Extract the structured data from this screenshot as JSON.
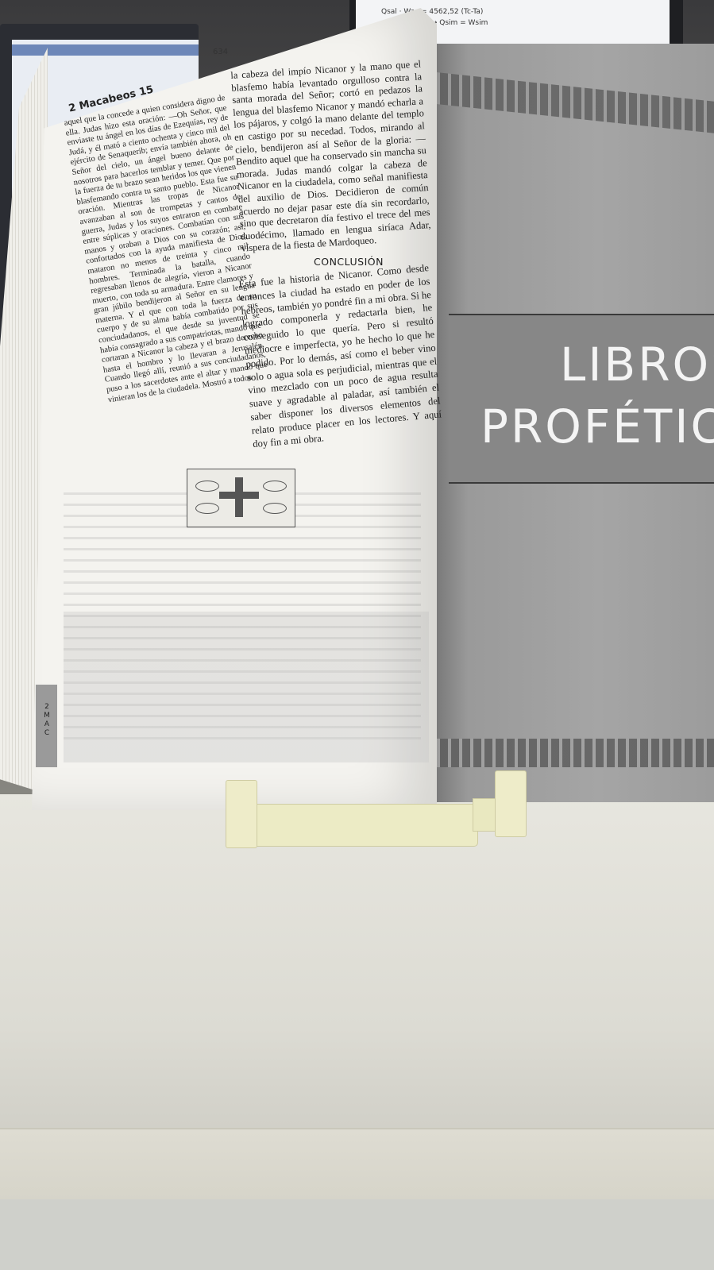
{
  "photo": {
    "subject": "open-bible-on-book-stand"
  },
  "left_page": {
    "running_head": "2 Macabeos 15",
    "page_number": "634",
    "section_heading": "CONCLUSIÓN",
    "thumb_tab": "2 MAC",
    "column_left_text": "aquel que la concede a quien considera digno de ella. Judas hizo esta oración: —Oh Señor, que enviaste tu ángel en los días de Ezequías, rey de Judá, y él mató a ciento ochenta y cinco mil del ejército de Senaquerib; envía también ahora, oh Señor del cielo, un ángel bueno delante de nosotros para hacerlos temblar y temer. Que por la fuerza de tu brazo sean heridos los que vienen blasfemando contra tu santo pueblo. Esta fue su oración. Mientras las tropas de Nicanor avanzaban al son de trompetas y cantos de guerra, Judas y los suyos entraron en combate entre súplicas y oraciones. Combatían con sus manos y oraban a Dios con su corazón; así, confortados con la ayuda manifiesta de Dios, mataron no menos de treinta y cinco mil hombres. Terminada la batalla, cuando regresaban llenos de alegría, vieron a Nicanor muerto, con toda su armadura. Entre clamores y gran júbilo bendijeron al Señor en su lengua materna. Y el que con toda la fuerza de su cuerpo y de su alma había combatido por sus conciudadanos, el que desde su juventud se había consagrado a sus compatriotas, mandó que cortaran a Nicanor la cabeza y el brazo derecho hasta el hombro y lo llevaran a Jerusalén. Cuando llegó allí, reunió a sus conciudadanos, puso a los sacerdotes ante el altar y mandó que vinieran los de la ciudadela. Mostró a todos",
    "column_right_text": "la cabeza del impío Nicanor y la mano que el blasfemo había levantado orgulloso contra la santa morada del Señor; cortó en pedazos la lengua del blasfemo Nicanor y mandó echarla a los pájaros, y colgó la mano delante del templo en castigo por su necedad. Todos, mirando al cielo, bendijeron así al Señor de la gloria: —Bendito aquel que ha conservado sin mancha su morada. Judas mandó colgar la cabeza de Nicanor en la ciudadela, como señal manifiesta del auxilio de Dios. Decidieron de común acuerdo no dejar pasar este día sin recordarlo, sino que decretaron día festivo el trece del mes duodécimo, llamado en lengua siríaca Adar, víspera de la fiesta de Mardoqueo.",
    "conclusion_text": "Ésta fue la historia de Nicanor. Como desde entonces la ciudad ha estado en poder de los hebreos, también yo pondré fin a mi obra. Si he logrado componerla y redactarla bien, he conseguido lo que quería. Pero si resultó mediocre e imperfecta, yo he hecho lo que he podido. Por lo demás, así como el beber vino solo o agua sola es perjudicial, mientras que el vino mezclado con un poco de agua resulta suave y agradable al paladar, así también el saber disponer los diversos elementos del relato produce placer en los lectores. Y aquí doy fin a mi obra."
  },
  "right_page": {
    "title_line_1": "LIBROS",
    "title_line_2": "PROFÉTICOS"
  },
  "background": {
    "monitor_equation_1": "Qsal · Wac = 4562,52  (Tc-Ta)",
    "monitor_equation_2": "→ Wsim + 47 → Qsim = Wsim"
  },
  "colors": {
    "page_paper": "#f4f3ef",
    "right_page_gray": "#9c9c9c",
    "stand_plastic": "#eeecc9",
    "desk": "#e3e2da"
  }
}
